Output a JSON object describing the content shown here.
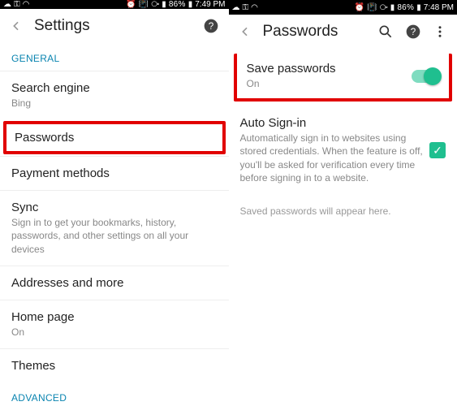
{
  "left": {
    "status": {
      "battery": "86%",
      "time": "7:49 PM"
    },
    "title": "Settings",
    "section_general": "GENERAL",
    "section_advanced": "ADVANCED",
    "items": {
      "search_engine": {
        "label": "Search engine",
        "sub": "Bing"
      },
      "passwords": {
        "label": "Passwords"
      },
      "payment": {
        "label": "Payment methods"
      },
      "sync": {
        "label": "Sync",
        "sub": "Sign in to get your bookmarks, history, passwords, and other settings on all your devices"
      },
      "addresses": {
        "label": "Addresses and more"
      },
      "homepage": {
        "label": "Home page",
        "sub": "On"
      },
      "themes": {
        "label": "Themes"
      }
    }
  },
  "right": {
    "status": {
      "battery": "86%",
      "time": "7:48 PM"
    },
    "title": "Passwords",
    "save_passwords": {
      "label": "Save passwords",
      "sub": "On"
    },
    "auto_signin": {
      "label": "Auto Sign-in",
      "sub": "Automatically sign in to websites using stored credentials. When the feature is off, you'll be asked for verification every time before signing in to a website."
    },
    "note": "Saved passwords will appear here."
  }
}
